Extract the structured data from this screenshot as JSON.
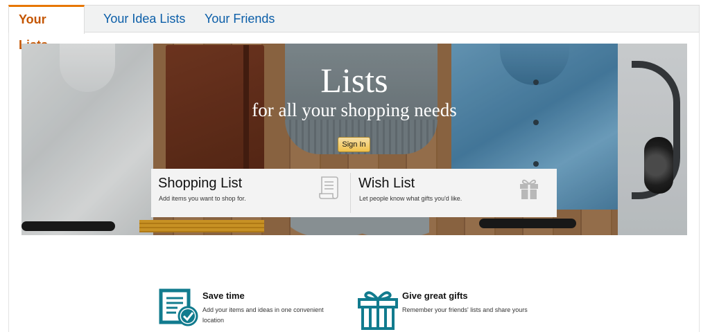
{
  "tabs": [
    {
      "label": "Your Lists",
      "active": true
    },
    {
      "label": "Your Idea Lists",
      "active": false
    },
    {
      "label": "Your Friends",
      "active": false
    }
  ],
  "hero": {
    "title": "Lists",
    "subtitle": "for all your shopping needs",
    "sign_in_label": "Sign In"
  },
  "cards": [
    {
      "title": "Shopping List",
      "description": "Add items you want to shop for.",
      "icon": "scroll-icon"
    },
    {
      "title": "Wish List",
      "description": "Let people know what gifts you'd like.",
      "icon": "gift-icon"
    }
  ],
  "features": [
    {
      "title": "Save time",
      "description": "Add your items and ideas in one convenient location",
      "icon": "checklist-icon"
    },
    {
      "title": "Give great gifts",
      "description": "Remember your friends' lists and share yours",
      "icon": "gift-box-icon"
    }
  ],
  "colors": {
    "accent_orange": "#e77600",
    "active_tab_text": "#c45500",
    "link_blue": "#0b5ea8",
    "teal_icon": "#117b8e",
    "button_yellow": "#f0c14b"
  }
}
